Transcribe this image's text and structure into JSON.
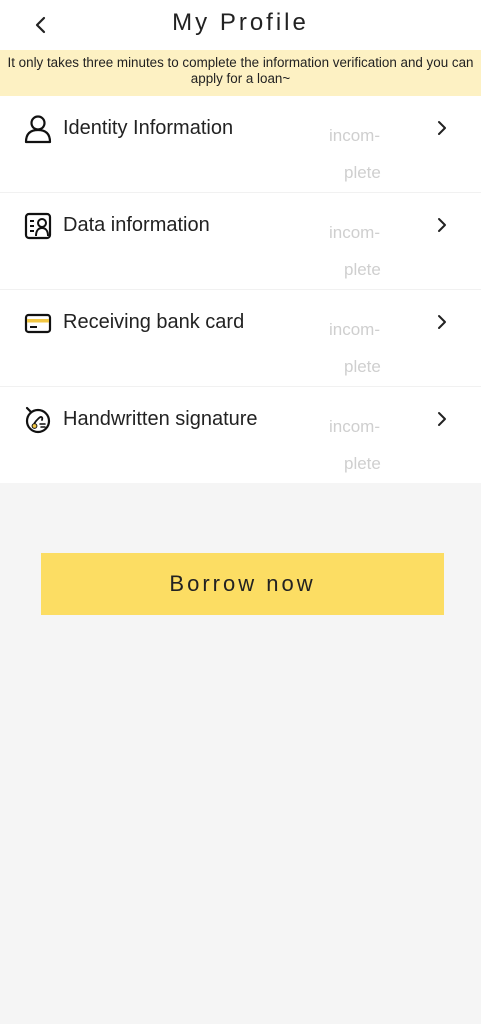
{
  "header": {
    "title": "My Profile",
    "back_icon": "chevron-left-icon"
  },
  "notice": {
    "text": "It only takes three minutes to complete the information verification and you can apply for a loan~",
    "background_color": "#fdf1c3"
  },
  "items": [
    {
      "label": "Identity Information",
      "status_line1": "incom-",
      "status_line2": "plete",
      "icon": "person-icon"
    },
    {
      "label": "Data information",
      "status_line1": "incom-",
      "status_line2": "plete",
      "icon": "id-card-icon"
    },
    {
      "label": "Receiving bank card",
      "status_line1": "incom-",
      "status_line2": "plete",
      "icon": "bank-card-icon"
    },
    {
      "label": "Handwritten signature",
      "status_line1": "incom-",
      "status_line2": "plete",
      "icon": "signature-icon"
    }
  ],
  "action": {
    "label": "Borrow now",
    "color": "#fcdd63"
  },
  "colors": {
    "status_text": "#cfcfcf",
    "page_background": "#f5f5f5"
  }
}
